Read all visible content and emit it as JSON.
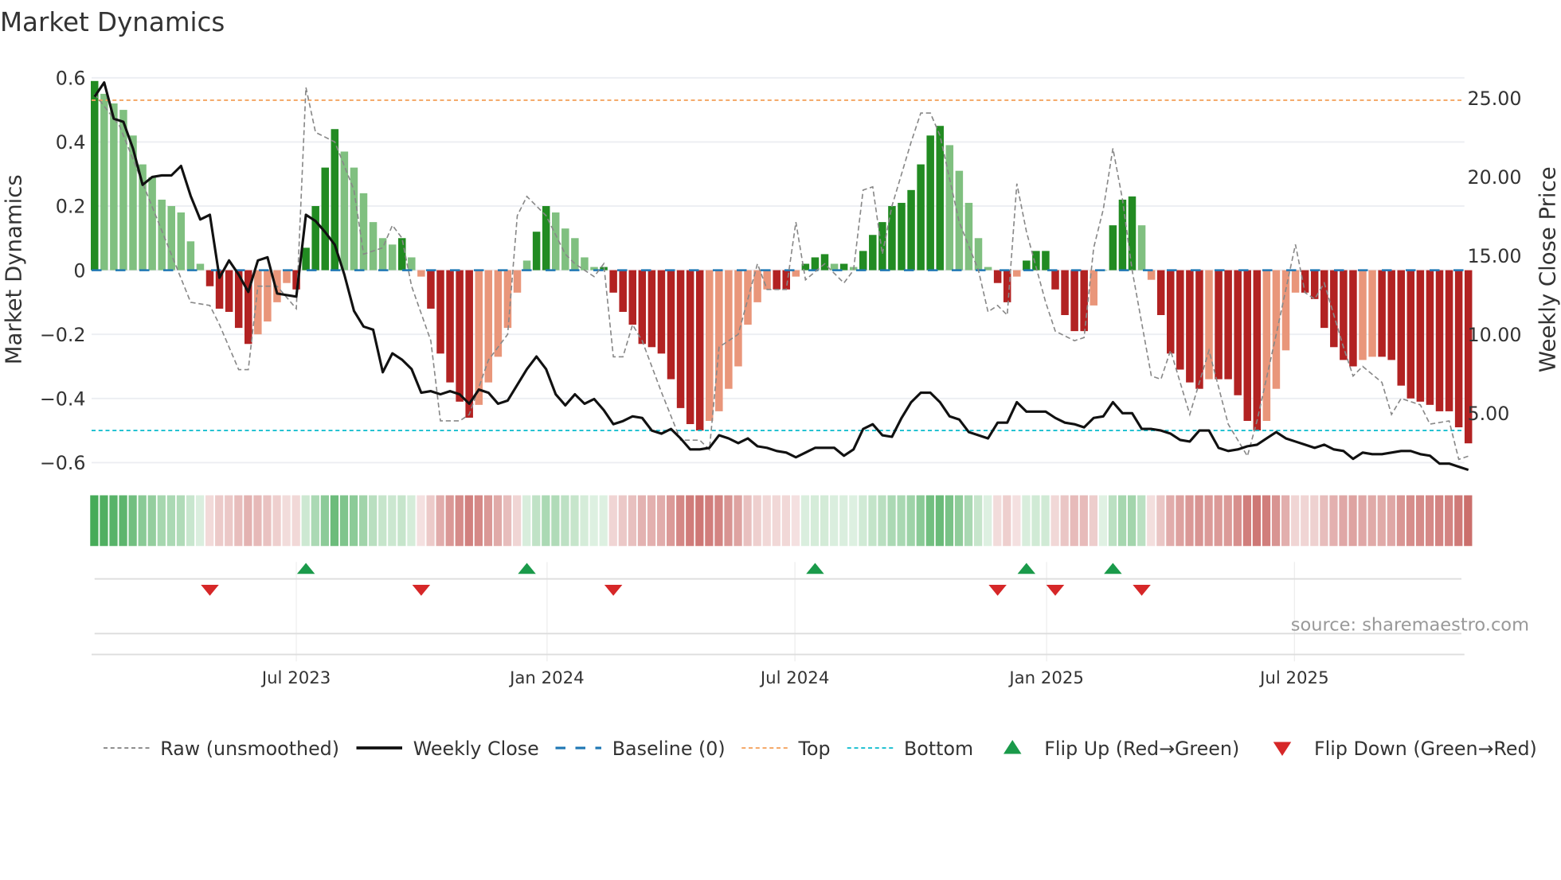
{
  "chart_data": {
    "type": "bar",
    "title": "Market Dynamics",
    "ylabel": "Market Dynamics",
    "y2label": "Weekly Close Price",
    "ylim": [
      -0.64,
      0.61
    ],
    "y2lim": [
      1.05,
      26.5
    ],
    "yticks": [
      {
        "v": 0.6,
        "label": "0.6"
      },
      {
        "v": 0.4,
        "label": "0.4"
      },
      {
        "v": 0.2,
        "label": "0.2"
      },
      {
        "v": 0,
        "label": "0"
      },
      {
        "v": -0.2,
        "label": "−0.2"
      },
      {
        "v": -0.4,
        "label": "−0.4"
      },
      {
        "v": -0.6,
        "label": "−0.6"
      }
    ],
    "y2ticks": [
      {
        "v": 25,
        "label": "25.00"
      },
      {
        "v": 20,
        "label": "20.00"
      },
      {
        "v": 15,
        "label": "15.00"
      },
      {
        "v": 10,
        "label": "10.00"
      },
      {
        "v": 5,
        "label": "5.00"
      }
    ],
    "xticks": [
      {
        "week": 21.0,
        "label": "Jul 2023"
      },
      {
        "week": 47.1,
        "label": "Jan 2024"
      },
      {
        "week": 72.9,
        "label": "Jul 2024"
      },
      {
        "week": 99.1,
        "label": "Jan 2025"
      },
      {
        "week": 124.9,
        "label": "Jul 2025"
      }
    ],
    "top_level": 0.53,
    "bottom_level": -0.5,
    "baseline": 0,
    "dynamics": [
      0.59,
      0.55,
      0.52,
      0.5,
      0.42,
      0.33,
      0.29,
      0.22,
      0.2,
      0.18,
      0.09,
      0.02,
      -0.05,
      -0.12,
      -0.13,
      -0.18,
      -0.23,
      -0.2,
      -0.16,
      -0.1,
      -0.04,
      -0.06,
      0.07,
      0.2,
      0.32,
      0.44,
      0.37,
      0.32,
      0.24,
      0.15,
      0.1,
      0.08,
      0.1,
      0.04,
      -0.02,
      -0.12,
      -0.26,
      -0.35,
      -0.41,
      -0.46,
      -0.42,
      -0.35,
      -0.27,
      -0.18,
      -0.07,
      0.03,
      0.12,
      0.2,
      0.18,
      0.13,
      0.1,
      0.04,
      0.01,
      0.01,
      -0.07,
      -0.13,
      -0.17,
      -0.23,
      -0.24,
      -0.26,
      -0.34,
      -0.43,
      -0.48,
      -0.5,
      -0.47,
      -0.44,
      -0.37,
      -0.3,
      -0.17,
      -0.1,
      -0.06,
      -0.06,
      -0.06,
      -0.02,
      0.02,
      0.04,
      0.05,
      0.02,
      0.02,
      0.01,
      0.06,
      0.11,
      0.15,
      0.2,
      0.21,
      0.25,
      0.33,
      0.42,
      0.45,
      0.39,
      0.31,
      0.21,
      0.1,
      0.01,
      -0.04,
      -0.1,
      -0.02,
      0.03,
      0.06,
      0.06,
      -0.06,
      -0.14,
      -0.19,
      -0.19,
      -0.11,
      0.0,
      0.14,
      0.22,
      0.23,
      0.14,
      -0.03,
      -0.14,
      -0.26,
      -0.31,
      -0.35,
      -0.37,
      -0.34,
      -0.34,
      -0.34,
      -0.39,
      -0.47,
      -0.5,
      -0.47,
      -0.37,
      -0.25,
      -0.07,
      -0.07,
      -0.09,
      -0.18,
      -0.24,
      -0.28,
      -0.3,
      -0.28,
      -0.27,
      -0.27,
      -0.28,
      -0.36,
      -0.4,
      -0.41,
      -0.42,
      -0.44,
      -0.44,
      -0.49,
      -0.54
    ],
    "raw": [
      [
        0,
        0.55
      ],
      [
        2.6,
        0.45
      ],
      [
        10,
        -0.1
      ],
      [
        12,
        -0.11
      ],
      [
        13,
        -0.17
      ],
      [
        15,
        -0.31
      ],
      [
        16,
        -0.31
      ],
      [
        17,
        -0.05
      ],
      [
        19,
        -0.05
      ],
      [
        21,
        -0.12
      ],
      [
        22,
        0.57
      ],
      [
        23,
        0.43
      ],
      [
        25,
        0.4
      ],
      [
        27,
        0.25
      ],
      [
        28,
        0.05
      ],
      [
        30,
        0.07
      ],
      [
        31,
        0.14
      ],
      [
        32,
        0.1
      ],
      [
        33,
        -0.05
      ],
      [
        35,
        -0.22
      ],
      [
        36,
        -0.47
      ],
      [
        38,
        -0.47
      ],
      [
        39,
        -0.45
      ],
      [
        41,
        -0.28
      ],
      [
        43,
        -0.2
      ],
      [
        44,
        0.17
      ],
      [
        45,
        0.23
      ],
      [
        47,
        0.17
      ],
      [
        49,
        0.05
      ],
      [
        50,
        0.02
      ],
      [
        52,
        -0.02
      ],
      [
        53,
        0.02
      ],
      [
        54,
        -0.27
      ],
      [
        55,
        -0.27
      ],
      [
        56,
        -0.17
      ],
      [
        57,
        -0.22
      ],
      [
        59,
        -0.38
      ],
      [
        61,
        -0.53
      ],
      [
        63,
        -0.53
      ],
      [
        64,
        -0.56
      ],
      [
        65,
        -0.24
      ],
      [
        67,
        -0.2
      ],
      [
        69,
        0.02
      ],
      [
        70,
        -0.06
      ],
      [
        72,
        -0.06
      ],
      [
        73,
        0.15
      ],
      [
        74,
        -0.03
      ],
      [
        76,
        0.02
      ],
      [
        78,
        -0.04
      ],
      [
        79,
        0.0
      ],
      [
        80,
        0.25
      ],
      [
        81,
        0.26
      ],
      [
        82,
        0.05
      ],
      [
        83,
        0.2
      ],
      [
        85,
        0.4
      ],
      [
        86,
        0.49
      ],
      [
        87,
        0.49
      ],
      [
        88,
        0.42
      ],
      [
        90,
        0.15
      ],
      [
        92,
        0.0
      ],
      [
        93,
        -0.13
      ],
      [
        94,
        -0.11
      ],
      [
        95,
        -0.14
      ],
      [
        96,
        0.27
      ],
      [
        97,
        0.12
      ],
      [
        99,
        -0.1
      ],
      [
        100,
        -0.19
      ],
      [
        102,
        -0.22
      ],
      [
        103,
        -0.21
      ],
      [
        104,
        0.07
      ],
      [
        105,
        0.19
      ],
      [
        106,
        0.38
      ],
      [
        107,
        0.22
      ],
      [
        108,
        0.0
      ],
      [
        110,
        -0.33
      ],
      [
        111,
        -0.34
      ],
      [
        112,
        -0.25
      ],
      [
        114,
        -0.45
      ],
      [
        116,
        -0.25
      ],
      [
        118,
        -0.48
      ],
      [
        120,
        -0.58
      ],
      [
        121,
        -0.47
      ],
      [
        123,
        -0.2
      ],
      [
        125,
        0.08
      ],
      [
        126,
        -0.07
      ],
      [
        127,
        -0.09
      ],
      [
        128,
        -0.04
      ],
      [
        130,
        -0.24
      ],
      [
        131,
        -0.33
      ],
      [
        132,
        -0.3
      ],
      [
        134,
        -0.35
      ],
      [
        135,
        -0.45
      ],
      [
        136,
        -0.4
      ],
      [
        138,
        -0.42
      ],
      [
        139,
        -0.48
      ],
      [
        141,
        -0.47
      ],
      [
        142,
        -0.59
      ],
      [
        143,
        -0.58
      ]
    ],
    "weekly_close": [
      25.1,
      26.0,
      23.7,
      23.5,
      21.8,
      19.5,
      20.0,
      20.1,
      20.1,
      20.7,
      18.8,
      17.3,
      17.6,
      13.6,
      14.7,
      13.8,
      12.7,
      14.7,
      14.9,
      12.6,
      12.5,
      12.4,
      17.6,
      17.2,
      16.5,
      15.7,
      13.8,
      11.5,
      10.5,
      10.3,
      7.6,
      8.8,
      8.4,
      7.8,
      6.3,
      6.4,
      6.2,
      6.4,
      6.2,
      5.6,
      6.5,
      6.3,
      5.6,
      5.8,
      6.8,
      7.8,
      8.6,
      7.8,
      6.2,
      5.5,
      6.2,
      5.6,
      5.9,
      5.2,
      4.3,
      4.5,
      4.8,
      4.7,
      3.9,
      3.7,
      4.0,
      3.4,
      2.7,
      2.7,
      2.8,
      3.6,
      3.4,
      3.1,
      3.4,
      2.9,
      2.8,
      2.6,
      2.5,
      2.2,
      2.5,
      2.8,
      2.8,
      2.8,
      2.3,
      2.7,
      4.0,
      4.3,
      3.6,
      3.5,
      4.7,
      5.7,
      6.3,
      6.3,
      5.7,
      4.8,
      4.6,
      3.8,
      3.6,
      3.4,
      4.4,
      4.4,
      5.7,
      5.1,
      5.1,
      5.1,
      4.7,
      4.4,
      4.3,
      4.1,
      4.7,
      4.8,
      5.7,
      5.0,
      5.0,
      4.0,
      4.0,
      3.9,
      3.7,
      3.3,
      3.2,
      3.9,
      3.9,
      2.8,
      2.6,
      2.7,
      2.9,
      3.0,
      3.4,
      3.8,
      3.4,
      3.2,
      3.0,
      2.8,
      3.0,
      2.7,
      2.6,
      2.1,
      2.5,
      2.4,
      2.4,
      2.5,
      2.6,
      2.6,
      2.4,
      2.3,
      1.8,
      1.8,
      1.6,
      1.4
    ],
    "flip_up_weeks": [
      22,
      45,
      75,
      97,
      106
    ],
    "flip_down_weeks": [
      12,
      34,
      54,
      94,
      100,
      109
    ],
    "legend_position": "bottom",
    "legend": [
      "Raw (unsmoothed)",
      "Weekly Close",
      "Baseline (0)",
      "Top",
      "Bottom",
      "Flip Up (Red→Green)",
      "Flip Down (Green→Red)"
    ],
    "colors": {
      "up_strong": "#228b22",
      "up_weak": "#80c080",
      "down_strong": "#b22222",
      "down_weak": "#e9967a",
      "raw": "#888888",
      "close": "#111111",
      "baseline": "#1f77b4",
      "top": "#f4a460",
      "bottom": "#17becf",
      "flip_up": "#1a9a4a",
      "flip_down": "#d62728"
    }
  },
  "source": "source: sharemaestro.com"
}
